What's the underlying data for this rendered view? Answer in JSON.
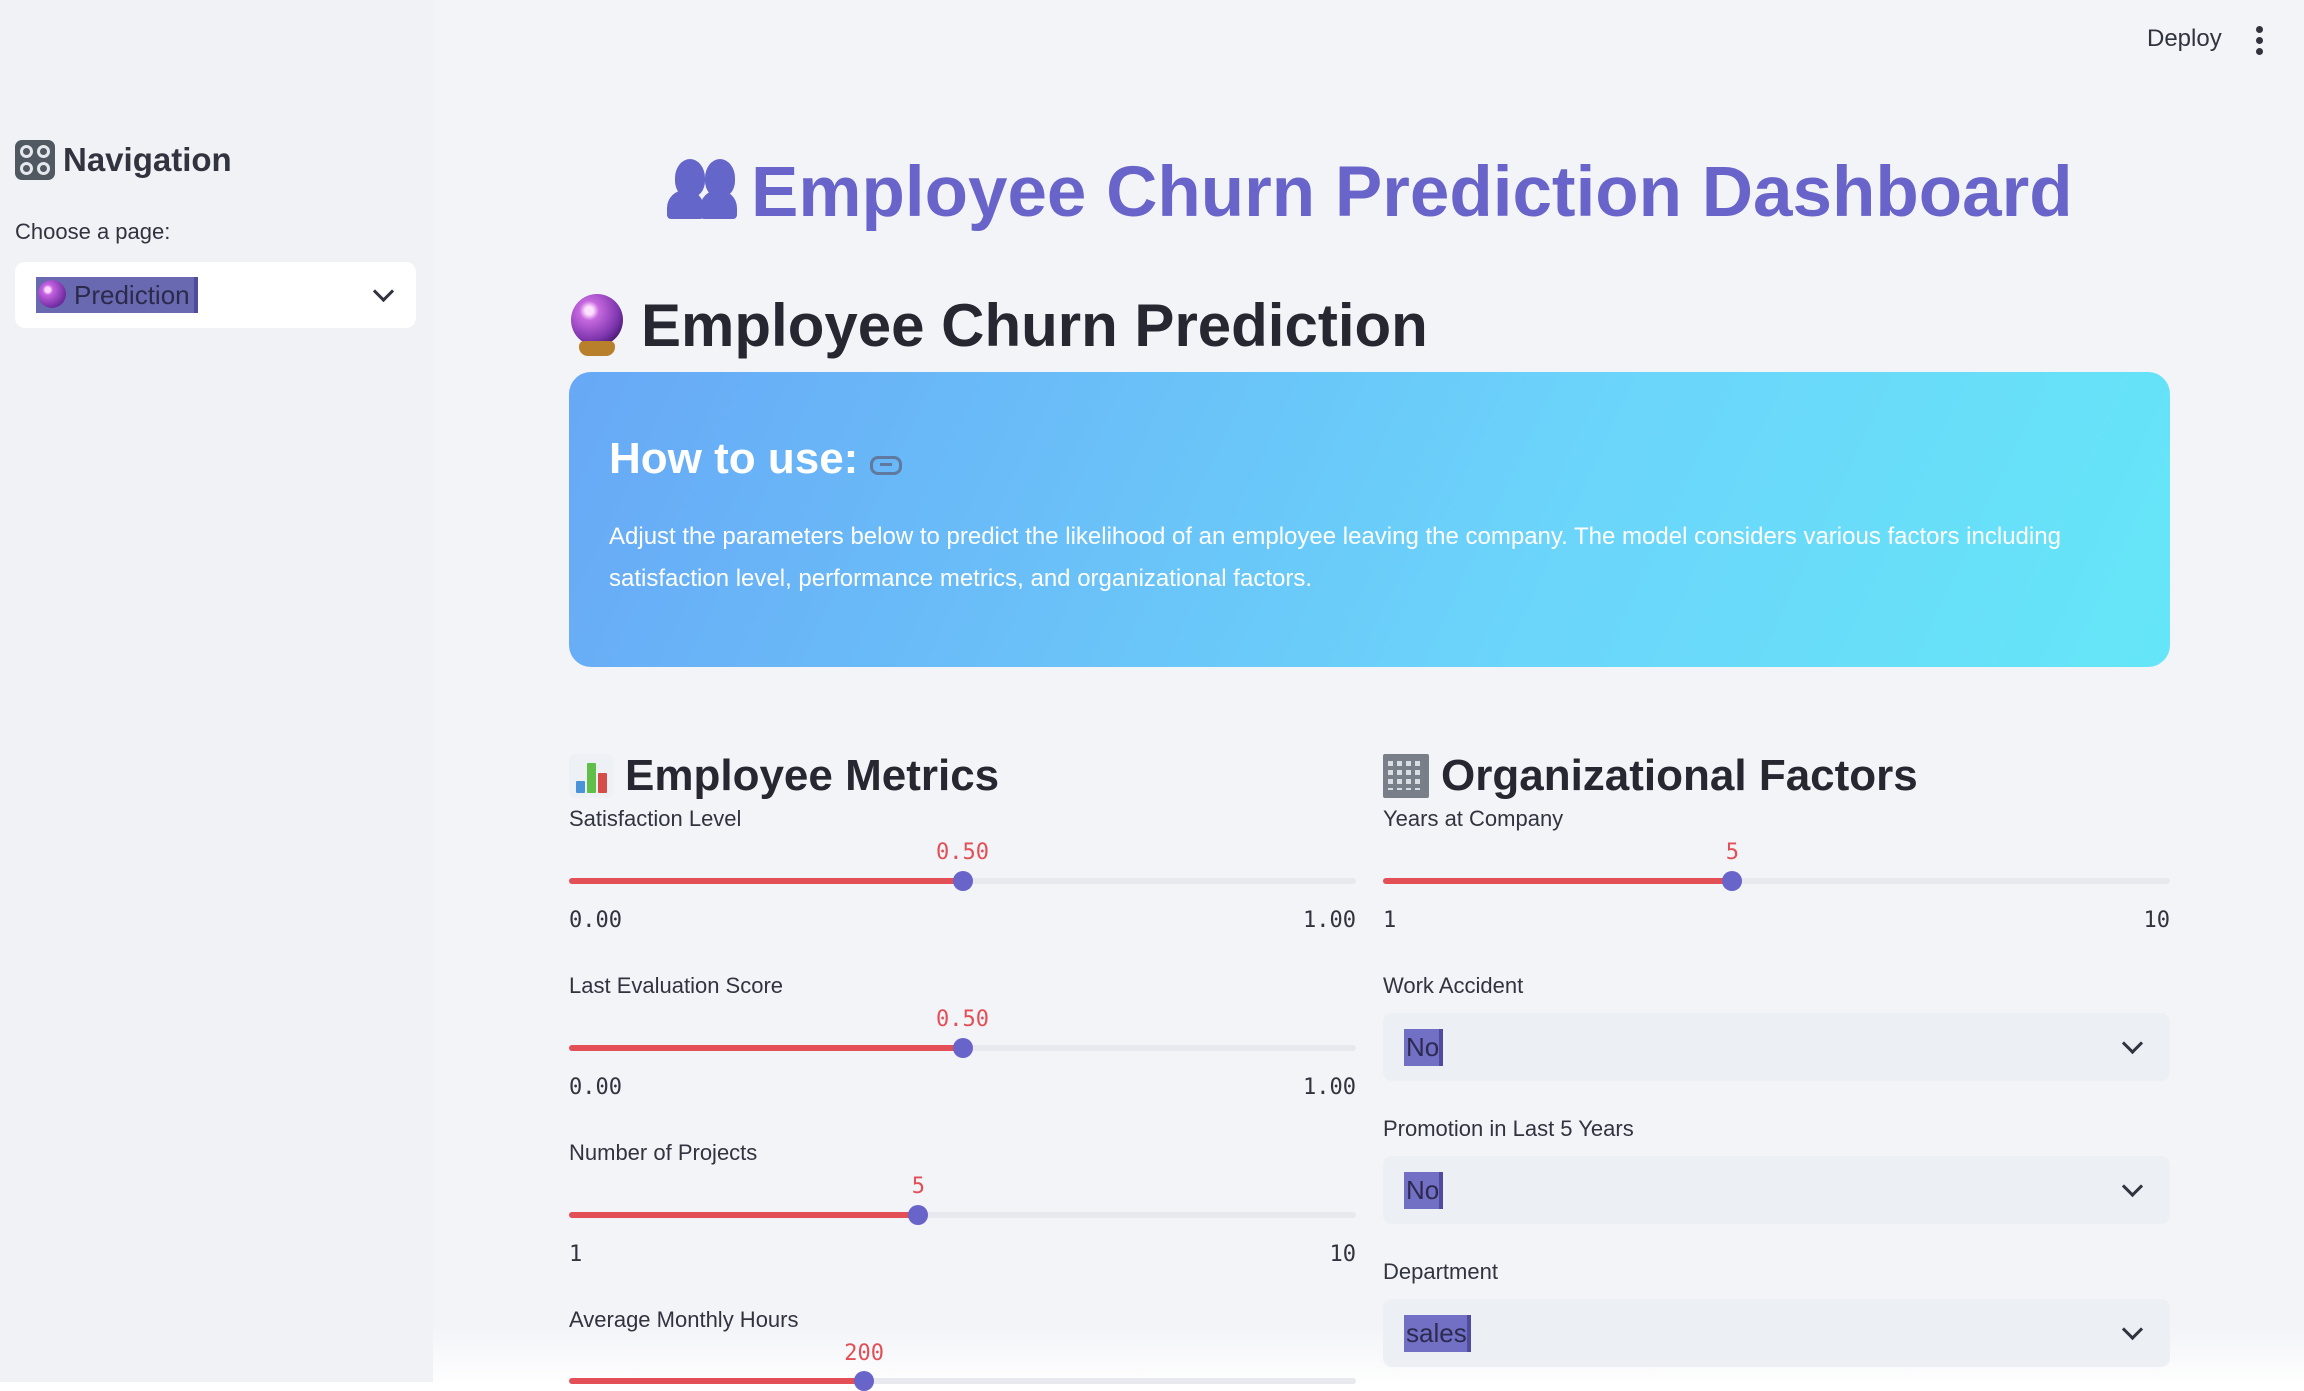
{
  "sidebar": {
    "title": "Navigation",
    "choose_label": "Choose a page:",
    "selected_page": "Prediction"
  },
  "header": {
    "deploy_label": "Deploy",
    "app_title": "Employee Churn Prediction Dashboard"
  },
  "main": {
    "subtitle": "Employee Churn Prediction",
    "howto": {
      "title": "How to use:",
      "text": "Adjust the parameters below to predict the likelihood of an employee leaving the company. The model considers various factors including satisfaction level, performance metrics, and organizational factors."
    },
    "left_section": {
      "title": "Employee Metrics",
      "sliders": [
        {
          "label": "Satisfaction Level",
          "value": "0.50",
          "min": "0.00",
          "max": "1.00",
          "fraction": 0.5
        },
        {
          "label": "Last Evaluation Score",
          "value": "0.50",
          "min": "0.00",
          "max": "1.00",
          "fraction": 0.5
        },
        {
          "label": "Number of Projects",
          "value": "5",
          "min": "1",
          "max": "10",
          "fraction": 0.444
        },
        {
          "label": "Average Monthly Hours",
          "value": "200",
          "fraction": 0.375
        }
      ]
    },
    "right_section": {
      "title": "Organizational Factors",
      "years_slider": {
        "label": "Years at Company",
        "value": "5",
        "min": "1",
        "max": "10",
        "fraction": 0.444
      },
      "work_accident": {
        "label": "Work Accident",
        "value": "No"
      },
      "promotion": {
        "label": "Promotion in Last 5 Years",
        "value": "No"
      },
      "department": {
        "label": "Department",
        "value": "sales"
      }
    }
  },
  "colors": {
    "accent": "#6964c9",
    "slider_fill": "#e24f57",
    "howto_start": "#68a8f6",
    "howto_end": "#65e6f8"
  },
  "icons": [
    "control-knobs-icon",
    "crystal-ball-icon",
    "people-icon",
    "link-icon",
    "bar-chart-icon",
    "office-building-icon",
    "chevron-down-icon",
    "menu-dots-icon"
  ]
}
